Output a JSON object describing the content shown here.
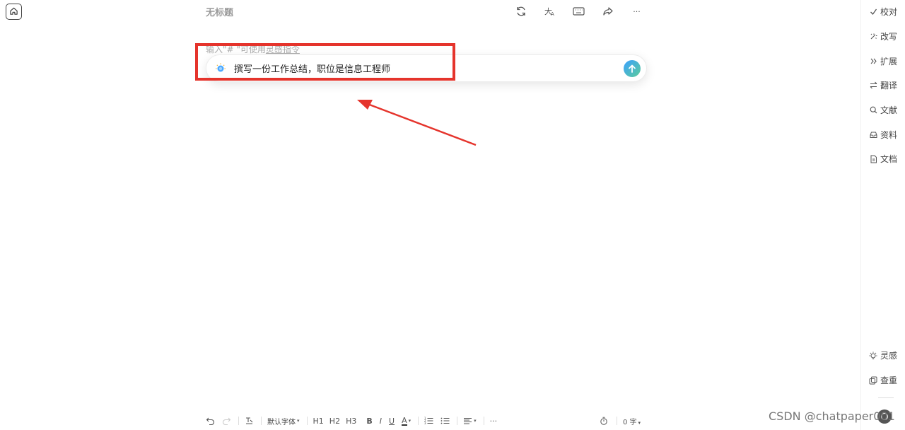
{
  "document": {
    "title": "无标题"
  },
  "editor": {
    "hint_prefix": "输入\"# \"可使用",
    "hint_link": "灵感指令",
    "prompt_value": "撰写一份工作总结，职位是信息工程师"
  },
  "top_toolbar": {
    "icons": [
      "refresh-icon",
      "translate-icon",
      "keyboard-icon",
      "share-icon",
      "more-icon"
    ],
    "more_label": "···"
  },
  "right_rail": {
    "items": [
      {
        "label": "校对",
        "icon": "check-icon"
      },
      {
        "label": "改写",
        "icon": "sparkle-icon"
      },
      {
        "label": "扩展",
        "icon": "double-chevron-icon"
      },
      {
        "label": "翻译",
        "icon": "swap-icon"
      },
      {
        "label": "文献",
        "icon": "search-icon"
      },
      {
        "label": "资料",
        "icon": "inbox-icon"
      },
      {
        "label": "文档",
        "icon": "document-icon"
      }
    ],
    "bottom_items": [
      {
        "label": "灵感",
        "icon": "lightbulb-icon"
      },
      {
        "label": "查重",
        "icon": "copy-icon"
      }
    ]
  },
  "bottom_toolbar": {
    "font": "默认字体",
    "h1": "H1",
    "h2": "H2",
    "h3": "H3",
    "bold": "B",
    "italic": "I",
    "underline": "U",
    "color": "A",
    "more": "···",
    "word_count": "0 字"
  },
  "watermark": "CSDN @chatpaper001",
  "colors": {
    "highlight": "#e5342c",
    "arrow": "#e5342c",
    "send_gradient_start": "#3aa0ff",
    "send_gradient_end": "#5ccc9a"
  }
}
